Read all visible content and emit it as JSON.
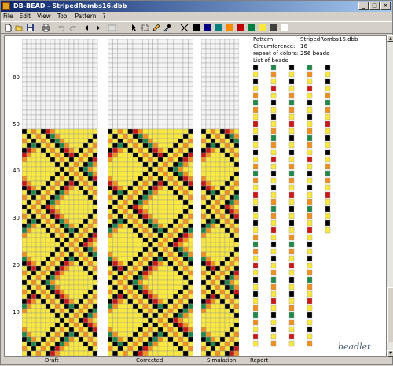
{
  "window": {
    "title": "DB-BEAD - StripedRombs16.dbb"
  },
  "menu": [
    "File",
    "Edit",
    "View",
    "Tool",
    "Pattern",
    "?"
  ],
  "toolbar": {
    "tools": [
      "new-icon",
      "open-icon",
      "save-icon",
      "print-icon",
      "undo-icon",
      "redo-icon",
      "arrow-left-icon",
      "arrow-right-icon",
      "preview-icon",
      "pointer-icon",
      "select-rect-icon",
      "pencil-icon",
      "eyedropper-icon"
    ],
    "colors": [
      "#000000",
      "#000080",
      "#008080",
      "#ff8c00",
      "#c00000",
      "#008040",
      "#f8e840",
      "#404040",
      "#ffffff"
    ]
  },
  "row_labels": [
    "60",
    "50",
    "40",
    "30",
    "20",
    "10"
  ],
  "panels": {
    "draft": "Draft",
    "corrected": "Corrected",
    "simulation": "Simulation",
    "report": "Report"
  },
  "report": {
    "pattern_label": "Pattern:",
    "pattern_value": "StripedRombs16.dbb",
    "circ_label": "Circumference:",
    "circ_value": "16",
    "repeat_label": "repeat of colors:",
    "repeat_value": "256 beads",
    "list_label": "List of beads"
  },
  "logo": "beadlet"
}
